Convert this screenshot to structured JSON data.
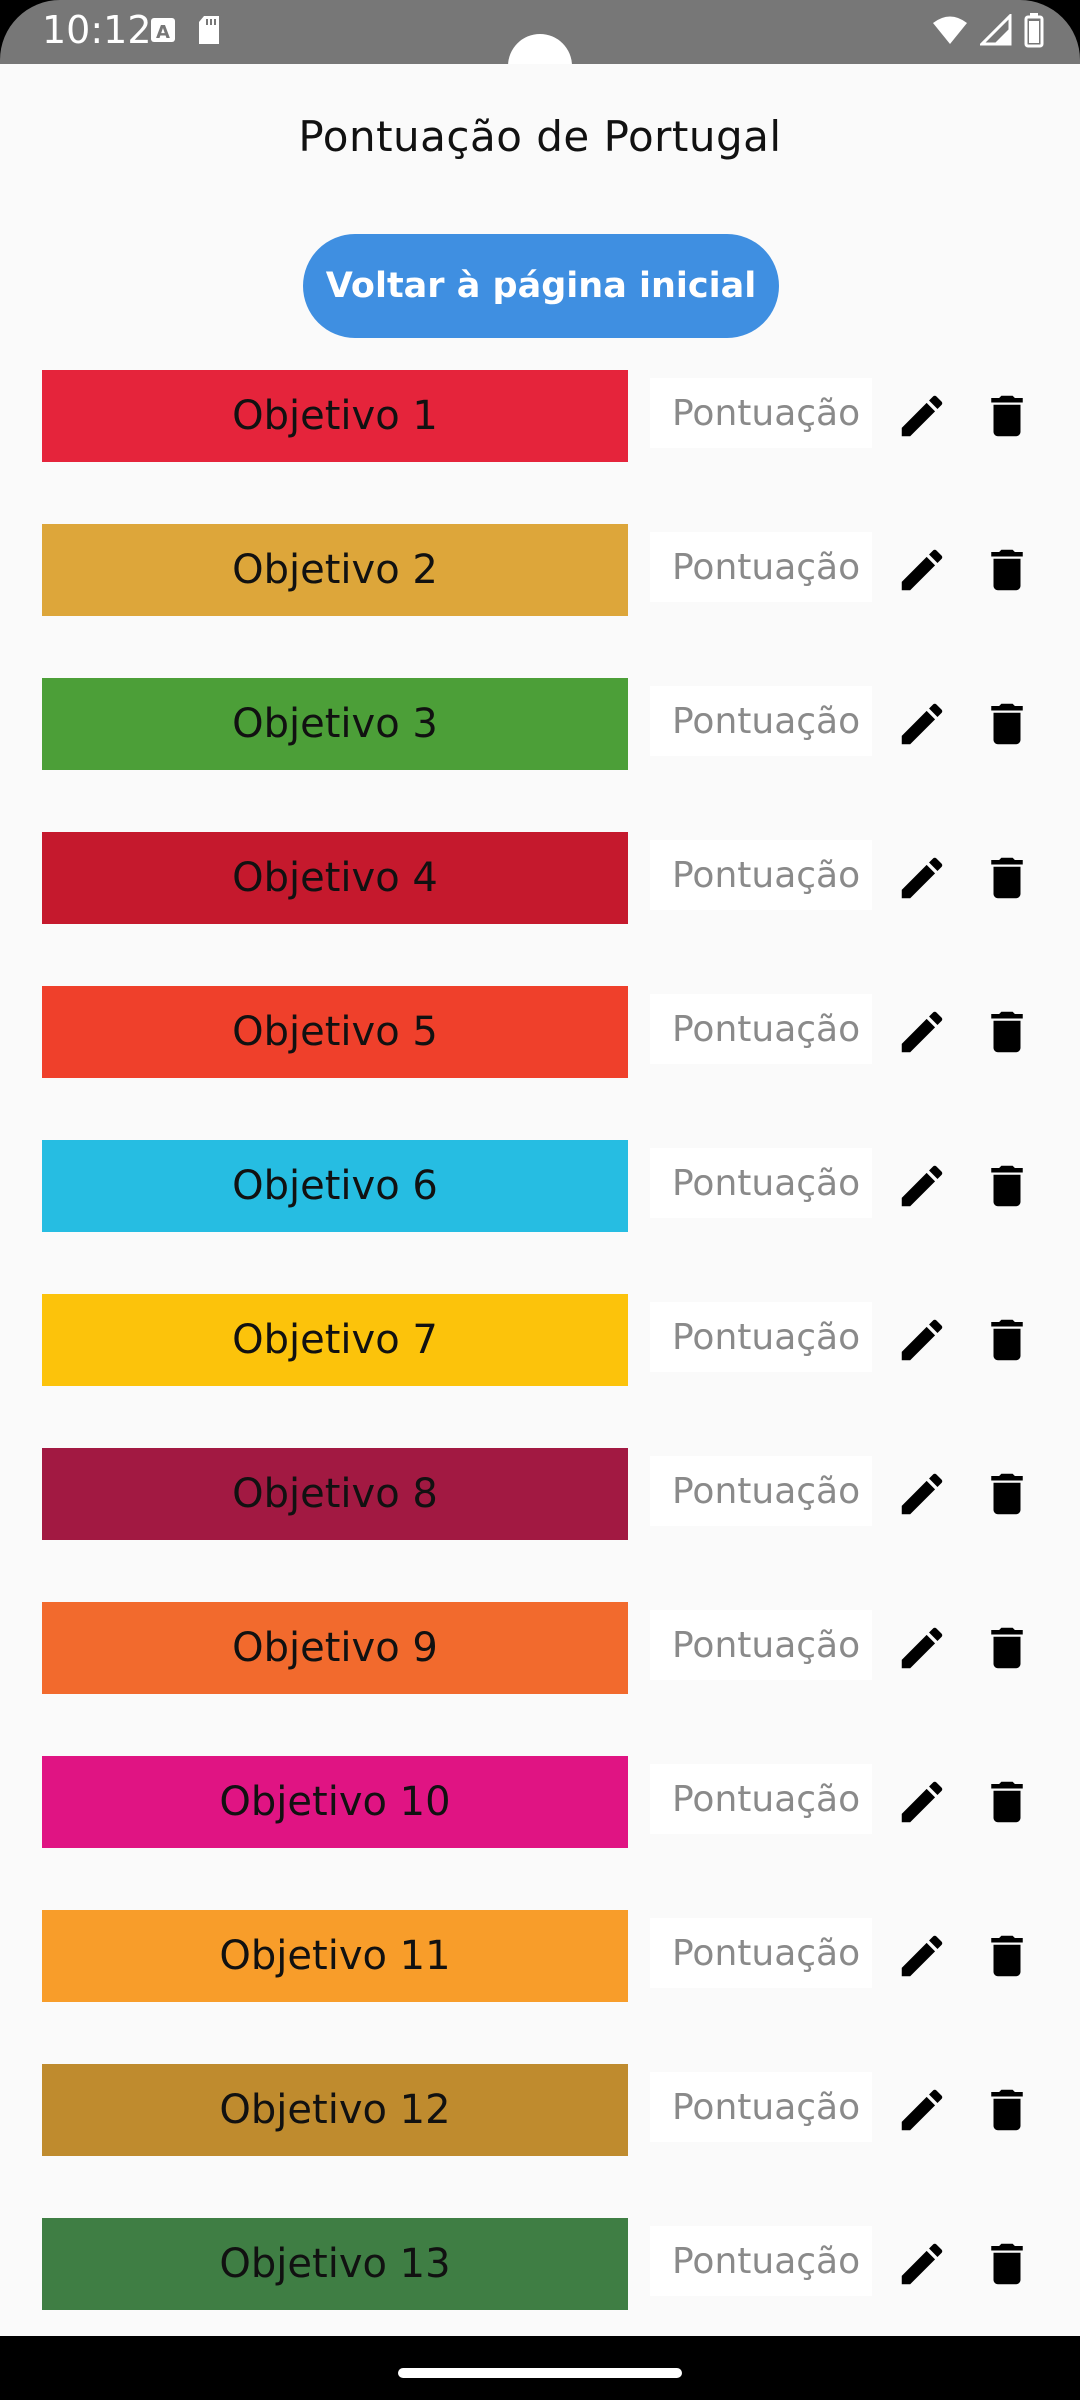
{
  "status_bar": {
    "time": "10:12",
    "icons": [
      "a-notification-icon",
      "sd-card-icon",
      "wifi-icon",
      "signal-icon",
      "battery-icon"
    ]
  },
  "header": {
    "title": "Pontuação de Portugal",
    "home_button_label": "Voltar à página inicial",
    "home_button_color": "#3f8fe1"
  },
  "score_placeholder": "Pontuação",
  "objectives": [
    {
      "label": "Objetivo 1",
      "color": "#e5243b"
    },
    {
      "label": "Objetivo 2",
      "color": "#dda63a"
    },
    {
      "label": "Objetivo 3",
      "color": "#4c9f38"
    },
    {
      "label": "Objetivo 4",
      "color": "#c5192d"
    },
    {
      "label": "Objetivo 5",
      "color": "#ef402b"
    },
    {
      "label": "Objetivo 6",
      "color": "#26bde2"
    },
    {
      "label": "Objetivo 7",
      "color": "#fcc30b"
    },
    {
      "label": "Objetivo 8",
      "color": "#a21942"
    },
    {
      "label": "Objetivo 9",
      "color": "#f26a2d"
    },
    {
      "label": "Objetivo 10",
      "color": "#e01483"
    },
    {
      "label": "Objetivo 11",
      "color": "#f89d2a"
    },
    {
      "label": "Objetivo 12",
      "color": "#bf8b2e"
    },
    {
      "label": "Objetivo 13",
      "color": "#3f7e44"
    }
  ],
  "row_icons": {
    "edit": "pencil-icon",
    "delete": "trash-icon"
  }
}
